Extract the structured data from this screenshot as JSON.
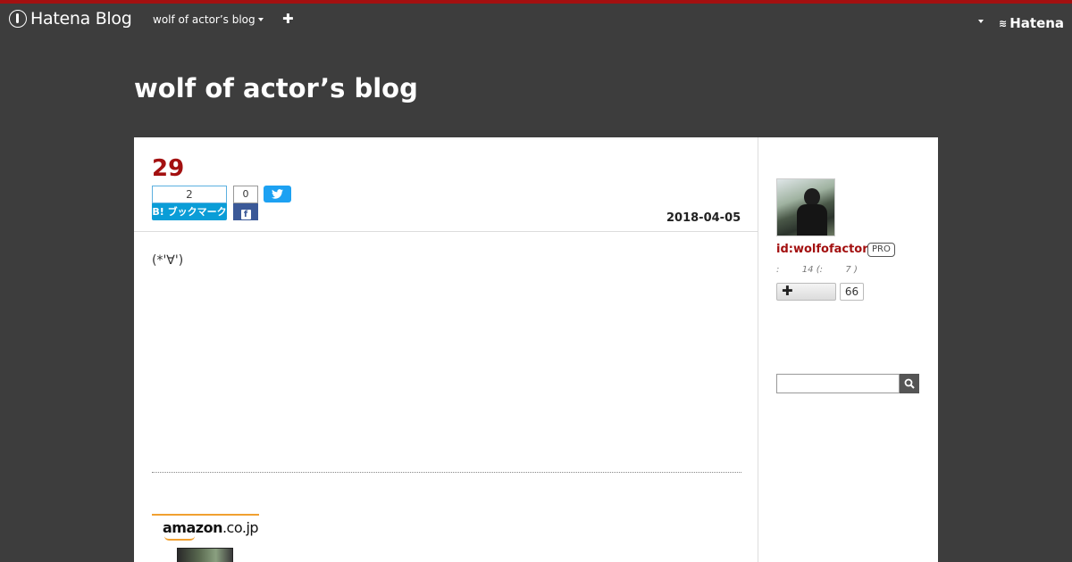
{
  "global_header": {
    "logo_text": "Hatena Blog",
    "blog_menu_label": "wolf of actor’s blog",
    "add_icon": "plus-icon",
    "brand_label": "Hatena"
  },
  "blog": {
    "title": "wolf of actor’s blog"
  },
  "entry": {
    "title": "29",
    "date": "2018-04-05",
    "body": "(*'∀')",
    "share": {
      "hatena_count": "2",
      "hatena_label": "B! ブックマーク",
      "facebook_count": "0"
    }
  },
  "ad": {
    "logo": "amazon",
    "logo_suffix": ".co.jp"
  },
  "sidebar": {
    "profile_id": "id:wolfofactor",
    "badge": "PRO",
    "stats": ":        14 (:        7 )",
    "follow_count": "66",
    "search_placeholder": ""
  },
  "colors": {
    "accent": "#a31010",
    "background": "#3d3d3d",
    "hatena_blue": "#0a9dd7",
    "facebook": "#3b5998",
    "twitter": "#1da1f2"
  }
}
